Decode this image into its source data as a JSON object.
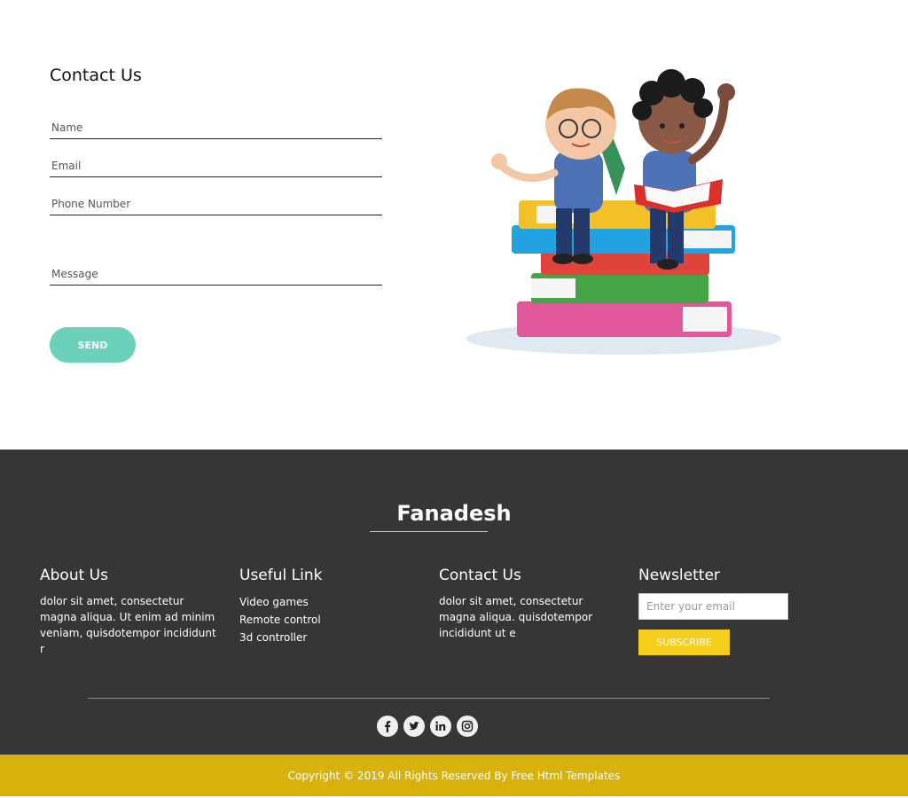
{
  "contact": {
    "title": "Contact Us",
    "fields": {
      "name": "Name",
      "email": "Email",
      "phone": "Phone Number",
      "message": "Message"
    },
    "send_label": "SEND"
  },
  "footer": {
    "brand": "Fanadesh",
    "about": {
      "title": "About Us",
      "text": "dolor sit amet, consectetur magna aliqua. Ut enim ad minim veniam, quisdotempor incididunt r"
    },
    "useful": {
      "title": "Useful Link",
      "links": [
        "Video games",
        "Remote control",
        "3d controller"
      ]
    },
    "contact": {
      "title": "Contact Us",
      "text": "dolor sit amet, consectetur magna aliqua. quisdotempor incididunt ut e"
    },
    "newsletter": {
      "title": "Newsletter",
      "placeholder": "Enter your email",
      "subscribe_label": "SUBSCRIBE"
    },
    "socials": [
      "facebook-icon",
      "twitter-icon",
      "linkedin-icon",
      "instagram-icon"
    ],
    "copyright": "Copyright © 2019 All Rights Reserved By Free Html Templates"
  },
  "colors": {
    "accent_teal": "#6bd1bb",
    "footer_bg": "#363636",
    "yellow": "#f5ce1c",
    "copyright_bg": "#d8b20a"
  }
}
